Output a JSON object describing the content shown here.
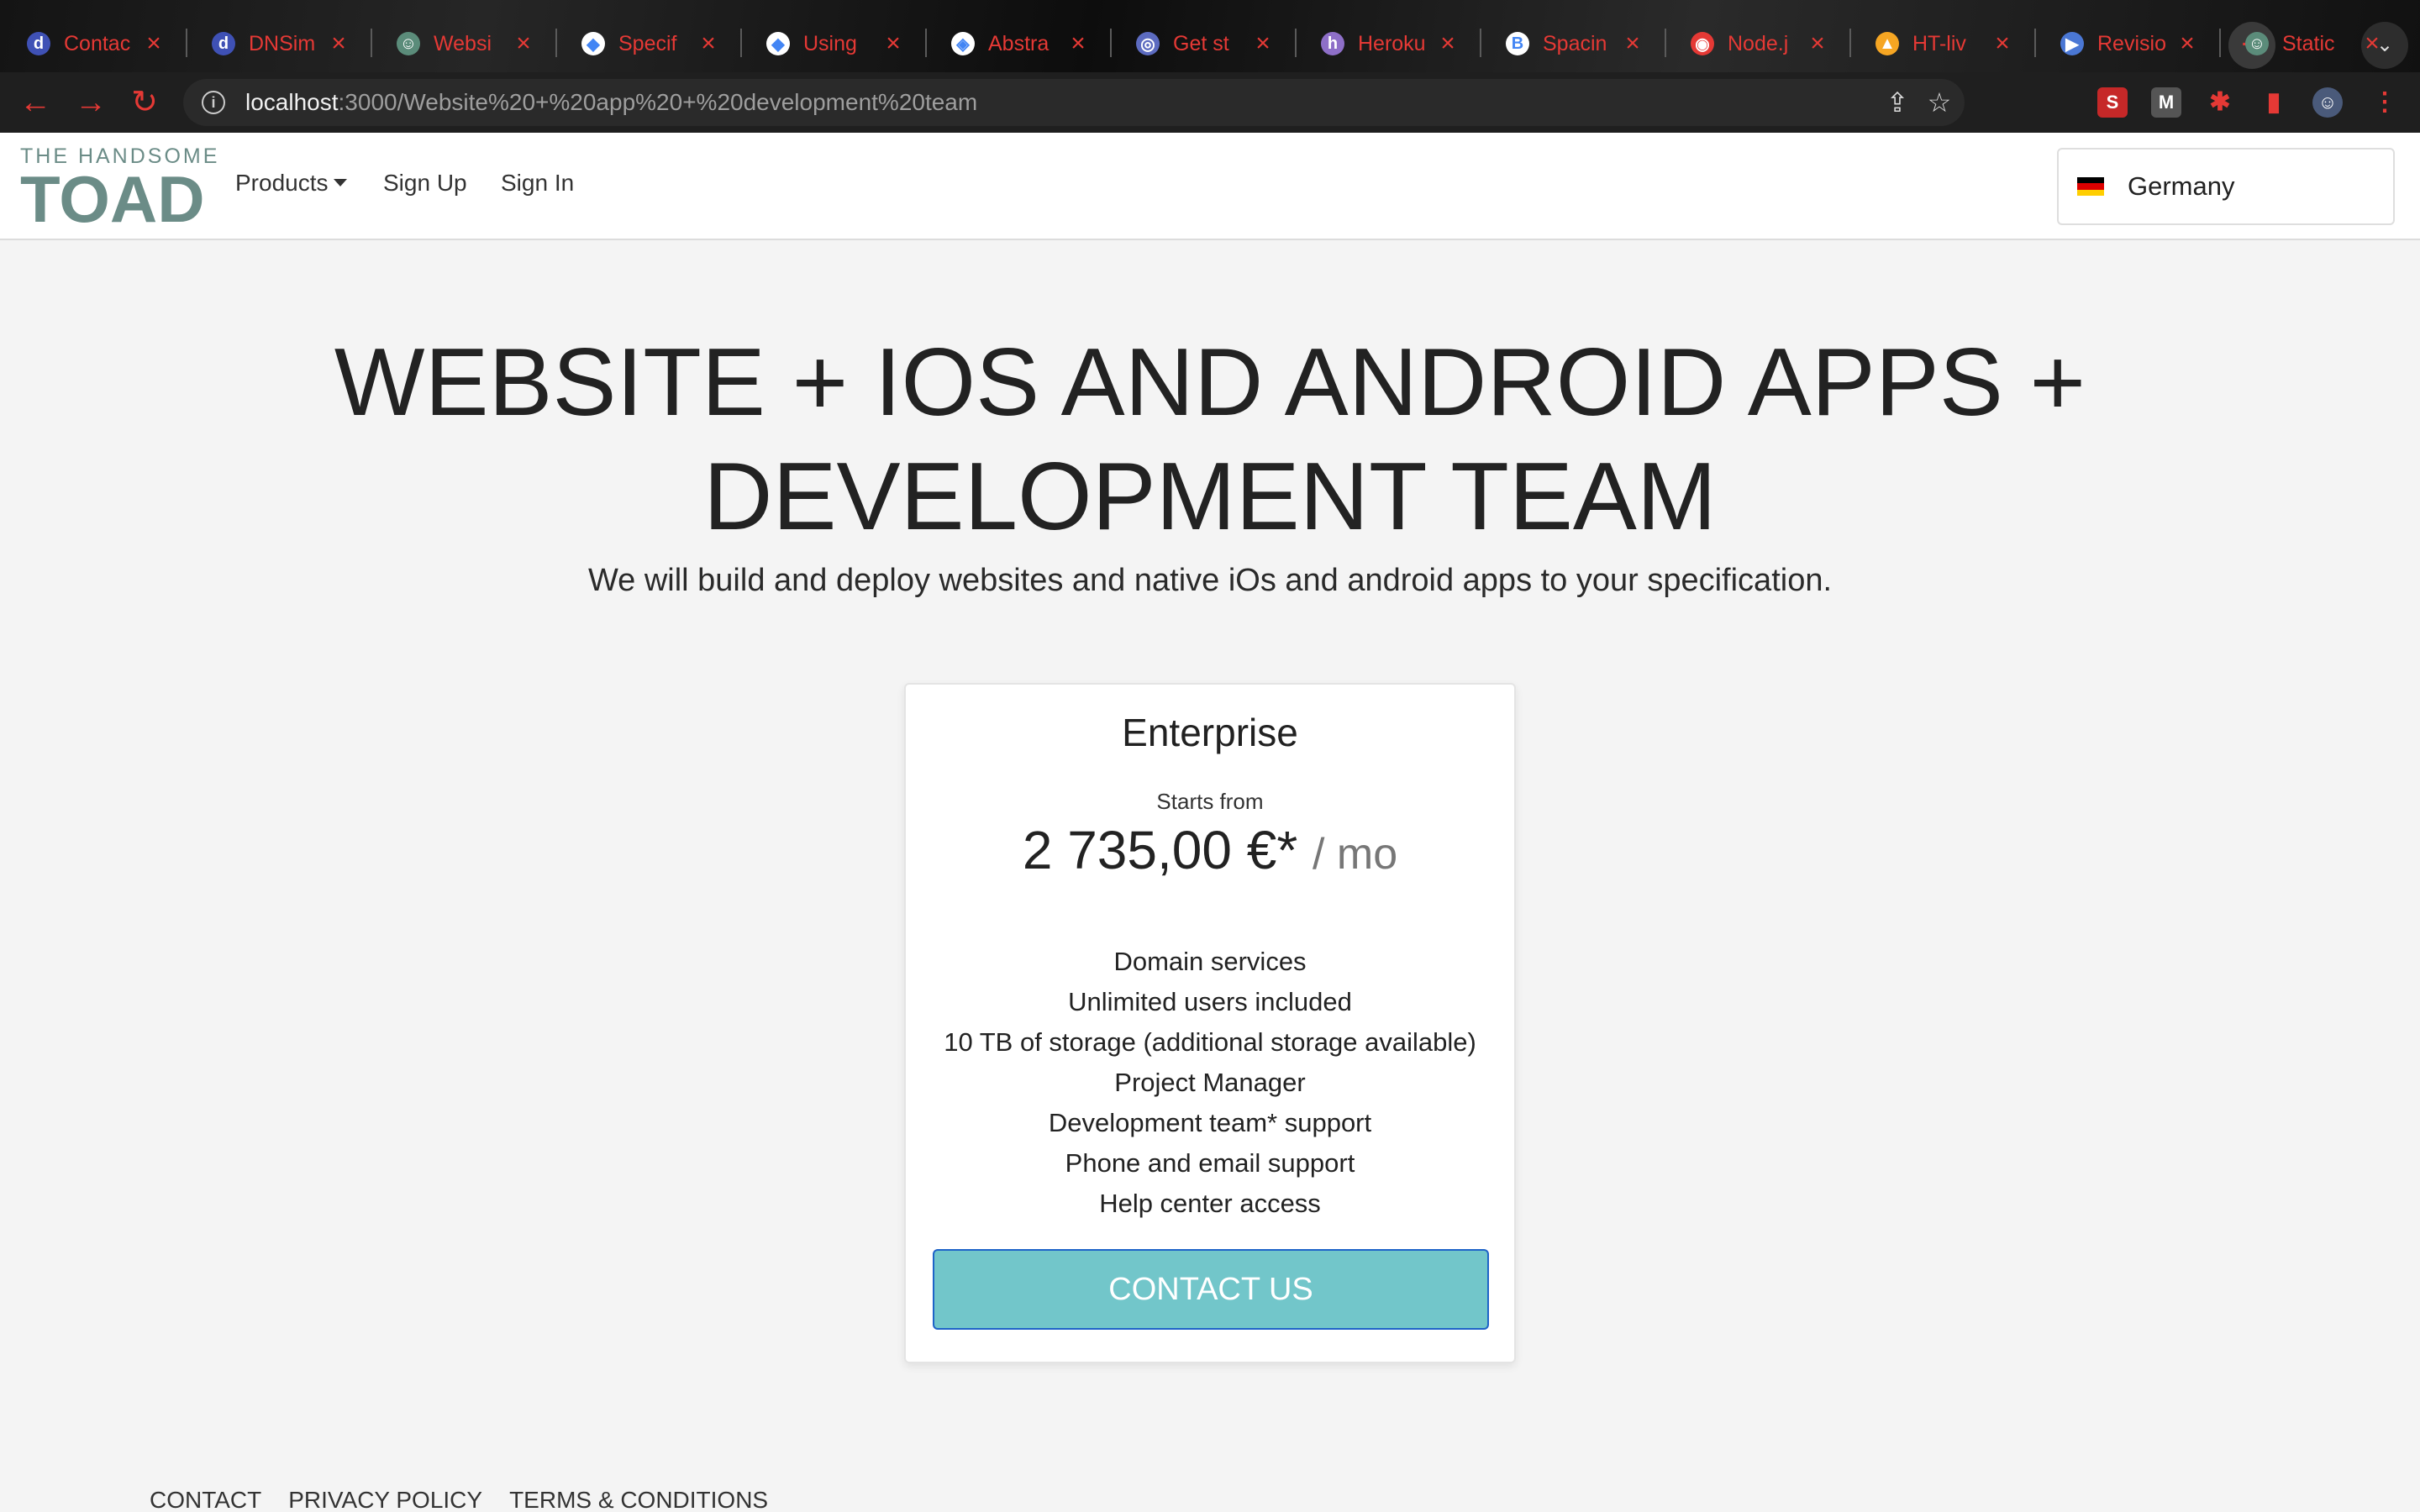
{
  "browser": {
    "tabs": [
      {
        "title": "Contac",
        "favicon": "dnsimple-d-icon",
        "color": "#3f51b5",
        "glyph": "d"
      },
      {
        "title": "DNSim",
        "favicon": "dnsimple-d-icon",
        "color": "#3f51b5",
        "glyph": "d"
      },
      {
        "title": "Websi",
        "favicon": "toad-icon",
        "color": "#5b8c7a",
        "glyph": "☺"
      },
      {
        "title": "Specif",
        "favicon": "google-cloud-icon",
        "color": "#ffffff",
        "glyph": "◆"
      },
      {
        "title": "Using",
        "favicon": "google-cloud-icon",
        "color": "#ffffff",
        "glyph": "◆"
      },
      {
        "title": "Abstra",
        "favicon": "diagram-icon",
        "color": "#ffffff",
        "glyph": "◈"
      },
      {
        "title": "Get st",
        "favicon": "target-icon",
        "color": "#5c6bc0",
        "glyph": "◎"
      },
      {
        "title": "Heroku",
        "favicon": "heroku-icon",
        "color": "#8e6fc8",
        "glyph": "h"
      },
      {
        "title": "Spacin",
        "favicon": "bootstrap-icon",
        "color": "#ffffff",
        "glyph": "B"
      },
      {
        "title": "Node.j",
        "favicon": "globe-icon",
        "color": "#e53935",
        "glyph": "◉"
      },
      {
        "title": "HT-liv",
        "favicon": "firebase-icon",
        "color": "#f6a623",
        "glyph": "▲"
      },
      {
        "title": "Revisio",
        "favicon": "play-icon",
        "color": "#4a77d4",
        "glyph": "▶"
      },
      {
        "title": "Static",
        "favicon": "toad-icon",
        "color": "#5b8c7a",
        "glyph": "☺"
      }
    ],
    "url_host": "localhost",
    "url_rest": ":3000/Website%20+%20app%20+%20development%20team"
  },
  "nav": {
    "logo_top": "THE HANDSOME",
    "logo_main": "TOAD",
    "products": "Products",
    "sign_up": "Sign Up",
    "sign_in": "Sign In",
    "country": "Germany",
    "flag_colors": [
      "#000000",
      "#dd0000",
      "#ffce00"
    ]
  },
  "hero": {
    "title": "WEBSITE + IOS AND ANDROID APPS + DEVELOPMENT TEAM",
    "subtitle": "We will build and deploy websites and native iOs and android apps to your specification."
  },
  "plan": {
    "name": "Enterprise",
    "starts_from": "Starts from",
    "price": "2 735,00 €*",
    "period": "/ mo",
    "features": [
      "Domain services",
      "Unlimited users included",
      "10 TB of storage (additional storage available)",
      "Project Manager",
      "Development team* support",
      "Phone and email support",
      "Help center access"
    ],
    "cta": "CONTACT US"
  },
  "footer": {
    "links": [
      "CONTACT",
      "PRIVACY POLICY",
      "TERMS & CONDITIONS"
    ]
  },
  "colors": {
    "accent": "#e53935",
    "cta_bg": "#72c6ca",
    "cta_border": "#1e63c8",
    "logo": "#6b8c87"
  }
}
